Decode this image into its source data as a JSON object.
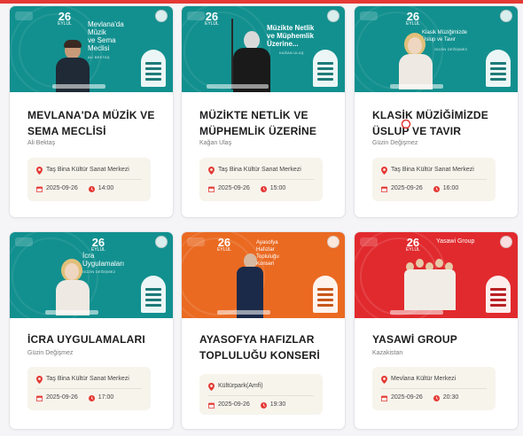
{
  "colors": {
    "accent": "#e53935",
    "teal": "#12908f",
    "orange": "#ea6a22",
    "red": "#e12a2e",
    "info_bg": "#f7f4ec"
  },
  "events": [
    {
      "poster": {
        "title_lines": [
          "Mevlana'da",
          "Müzik",
          "ve Sema",
          "Meclisi"
        ],
        "name": "ALİ BEKTAŞ",
        "day": "26",
        "month": "EYLÜL"
      },
      "title": "MEVLANA'DA MÜZİK VE SEMA MECLİSİ",
      "performer": "Ali Bektaş",
      "venue": "Taş Bina Kültür Sanat Merkezi",
      "date": "2025-09-26",
      "time": "14:00"
    },
    {
      "poster": {
        "title_lines": [
          "Müzikte Netlik",
          "ve Müphemlik",
          "Üzerine..."
        ],
        "name": "KAĞAN ULAŞ",
        "day": "26",
        "month": "EYLÜL"
      },
      "title": "MÜZİKTE NETLİK VE MÜPHEMLİK ÜZERİNE",
      "performer": "Kağan Ulaş",
      "venue": "Taş Bina Kültür Sanat Merkezi",
      "date": "2025-09-26",
      "time": "15:00"
    },
    {
      "poster": {
        "title_lines": [
          "Klasik Müziğimizde",
          "Üslup ve Tavır"
        ],
        "name": "GÜZİN DEĞİŞMEZ",
        "day": "26",
        "month": "EYLÜL"
      },
      "title": "KLASİK MÜZİĞİMİZDE ÜSLUP VE TAVIR",
      "performer": "Güzin Değişmez",
      "venue": "Taş Bina Kültür Sanat Merkezi",
      "date": "2025-09-26",
      "time": "16:00"
    },
    {
      "poster": {
        "title_lines": [
          "İcra",
          "Uygulamaları"
        ],
        "name": "GÜZİN DEĞİŞMEZ",
        "day": "26",
        "month": "EYLÜL"
      },
      "title": "İCRA UYGULAMALARI",
      "performer": "Güzin Değişmez",
      "venue": "Taş Bina Kültür Sanat Merkezi",
      "date": "2025-09-26",
      "time": "17:00"
    },
    {
      "poster": {
        "title_lines": [
          "Ayasofya",
          "Hafızlar",
          "Topluluğu",
          "Konseri"
        ],
        "name": "",
        "day": "26",
        "month": "EYLÜL"
      },
      "title": "AYASOFYA HAFIZLAR TOPLULUĞU KONSERİ",
      "performer": "",
      "venue": "Kültürpark(Amfi)",
      "date": "2025-09-26",
      "time": "19:30"
    },
    {
      "poster": {
        "title_lines": [
          "Yasawi Group"
        ],
        "name": "",
        "day": "26",
        "month": "EYLÜL"
      },
      "title": "YASAWİ GROUP",
      "performer": "Kazakistan",
      "venue": "Mevlana Kültür Merkezi",
      "date": "2025-09-26",
      "time": "20:30"
    }
  ]
}
